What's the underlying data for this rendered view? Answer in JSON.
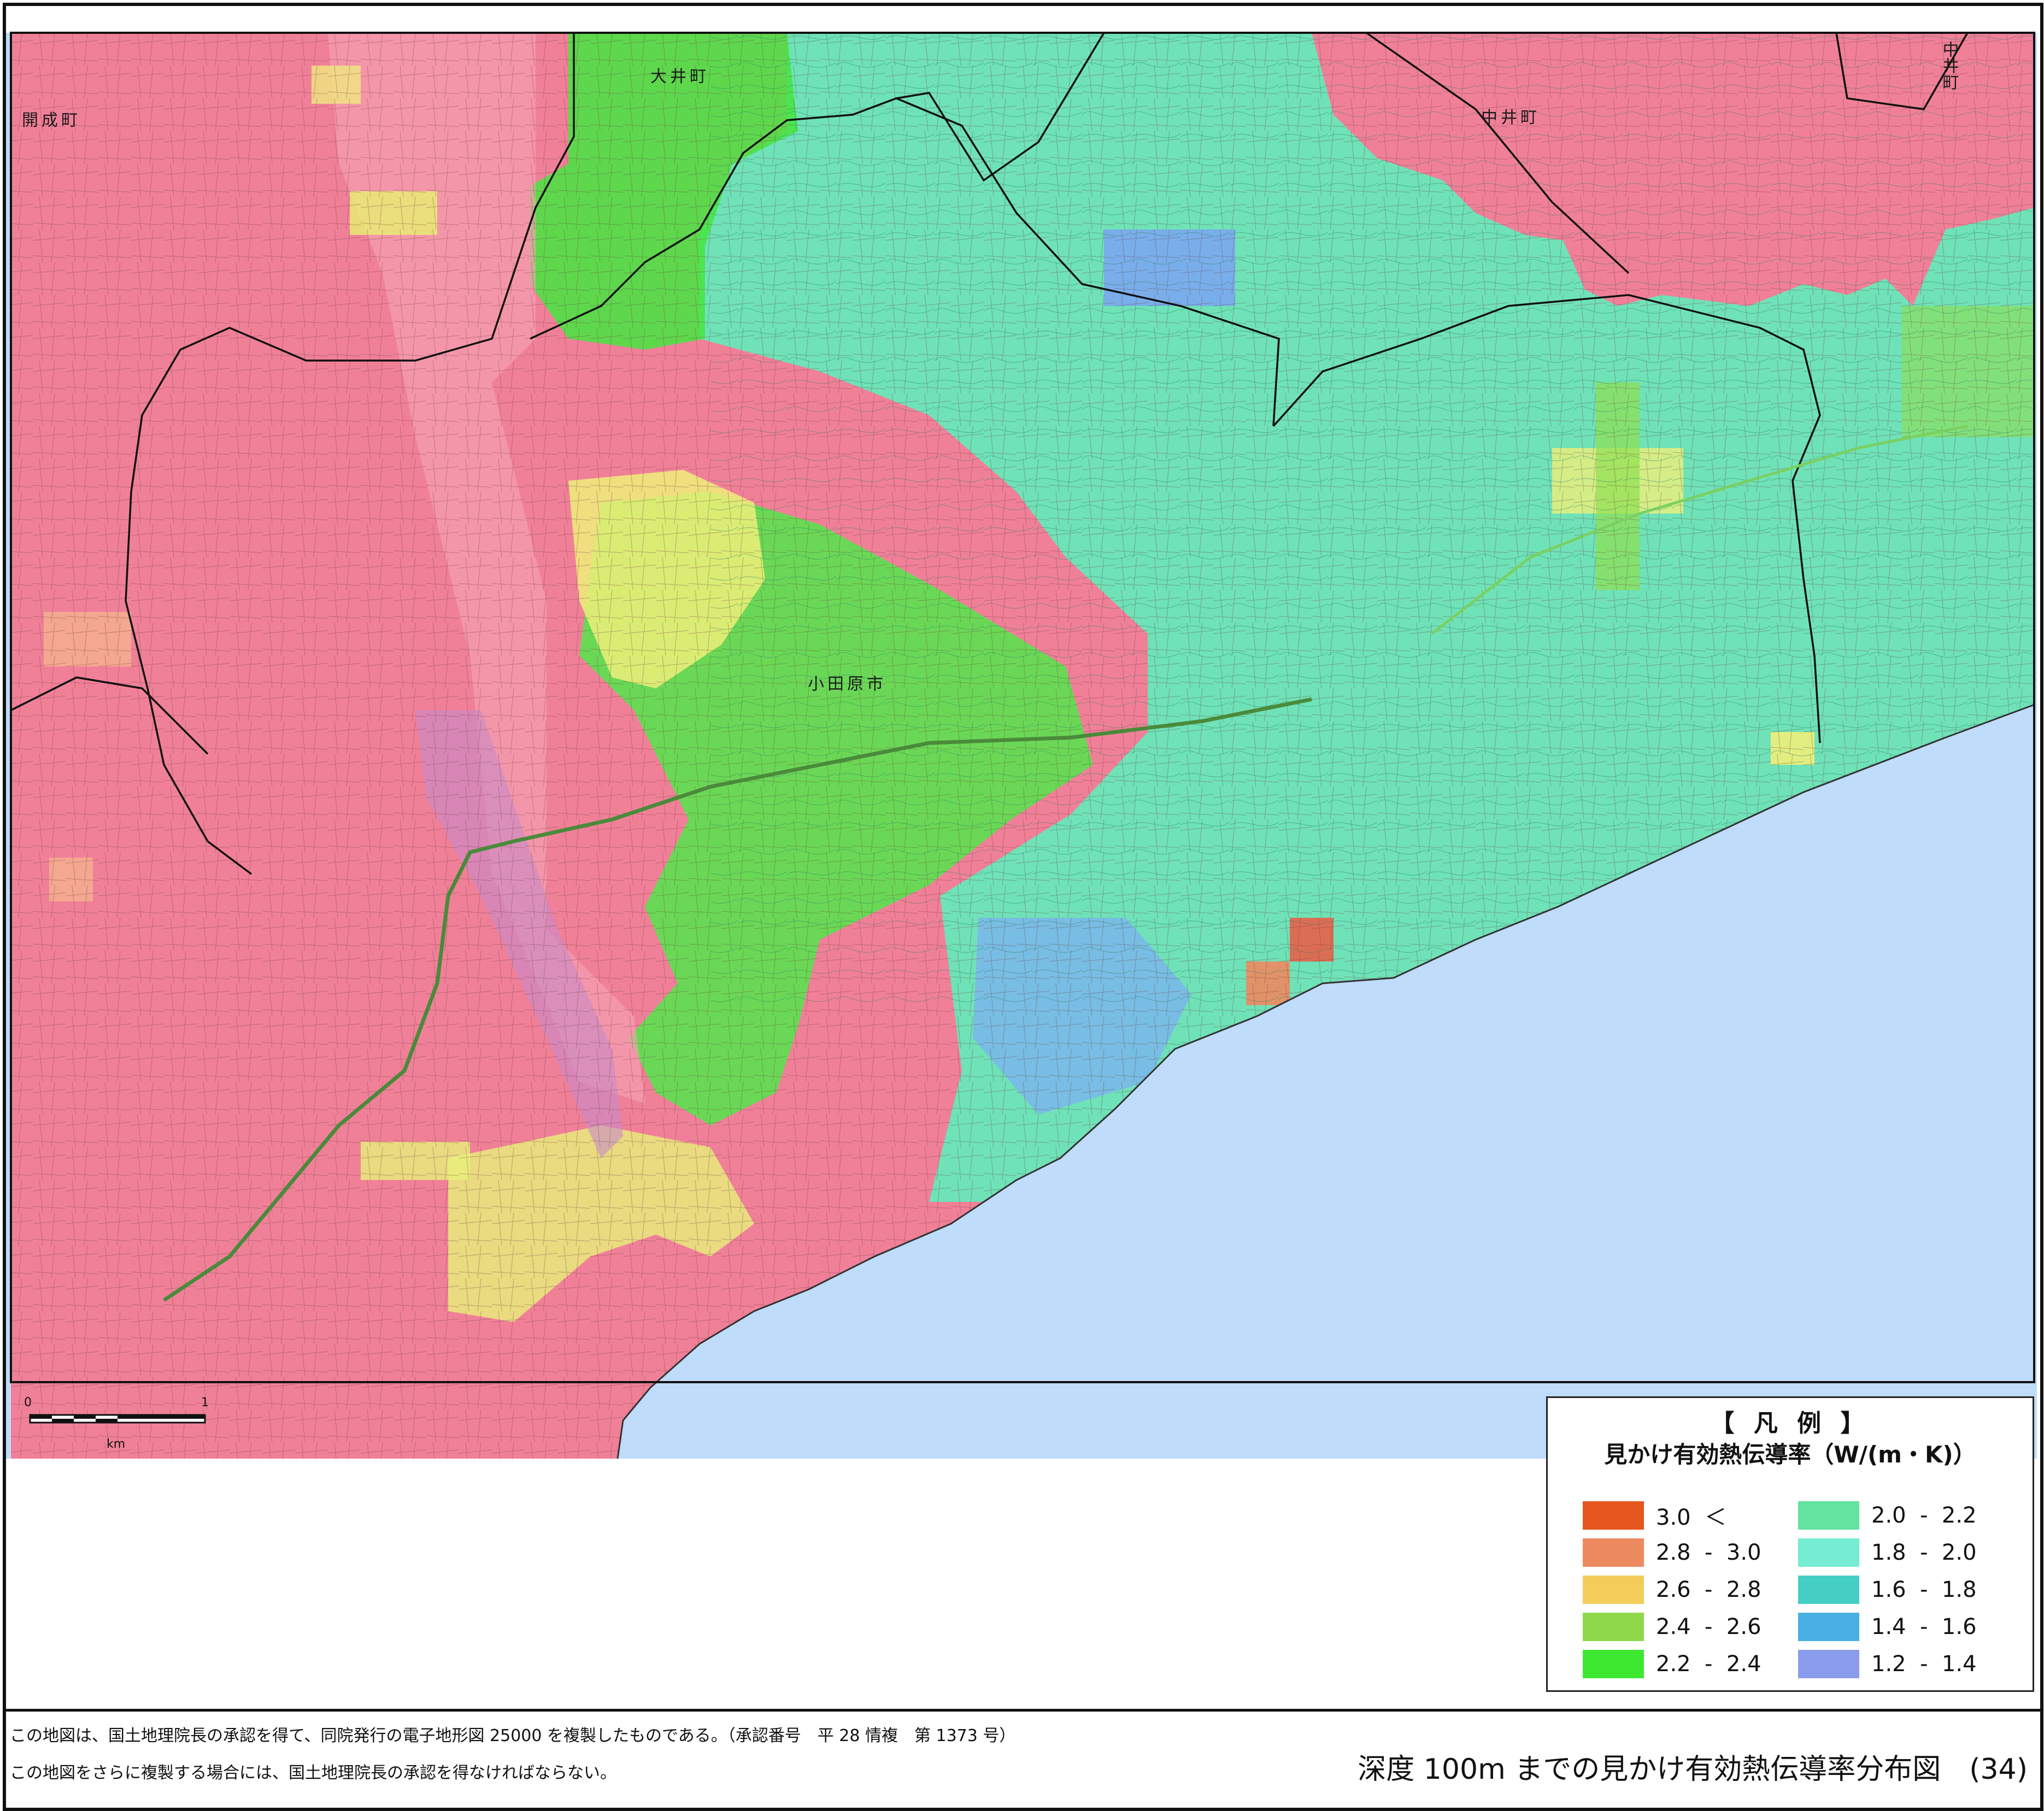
{
  "map": {
    "place_labels": {
      "kaisei": "開成町",
      "oi": "大井町",
      "nakai_h": "中井町",
      "nakai_v": "中井町",
      "odawara": "小田原市"
    },
    "colors": {
      "sea": "#bfdcfa",
      "land_pink": "#f08098",
      "pink_light": "#f5a0b0",
      "frame_line": "#111111"
    }
  },
  "scale_bar": {
    "label_zero": "0",
    "label_one": "1",
    "unit": "km"
  },
  "legend": {
    "title": "【 凡 例 】",
    "subtitle": "見かけ有効熱伝導率（W/(m・K)）",
    "items": [
      {
        "label": "3.0  ＜",
        "color": "#e4561c"
      },
      {
        "label": "2.8  -  3.0",
        "color": "#ee8a60"
      },
      {
        "label": "2.6  -  2.8",
        "color": "#f3cd5a"
      },
      {
        "label": "2.4  -  2.6",
        "color": "#8fd84a"
      },
      {
        "label": "2.2  -  2.4",
        "color": "#3ee830"
      },
      {
        "label": "2.0  -  2.2",
        "color": "#62e3a0"
      },
      {
        "label": "1.8  -  2.0",
        "color": "#76ecd2"
      },
      {
        "label": "1.6  -  1.8",
        "color": "#45cfc4"
      },
      {
        "label": "1.4  -  1.6",
        "color": "#4ab0e4"
      },
      {
        "label": "1.2  -  1.4",
        "color": "#8c9cec"
      }
    ]
  },
  "credits": {
    "line1": "この地図は、国土地理院長の承認を得て、同院発行の電子地形図 25000 を複製したものである。（承認番号　平 28 情複　第 1373 号）",
    "line2": "この地図をさらに複製する場合には、国土地理院長の承認を得なければならない。"
  },
  "page_title": "深度 100m までの見かけ有効熱伝導率分布図　(34)"
}
